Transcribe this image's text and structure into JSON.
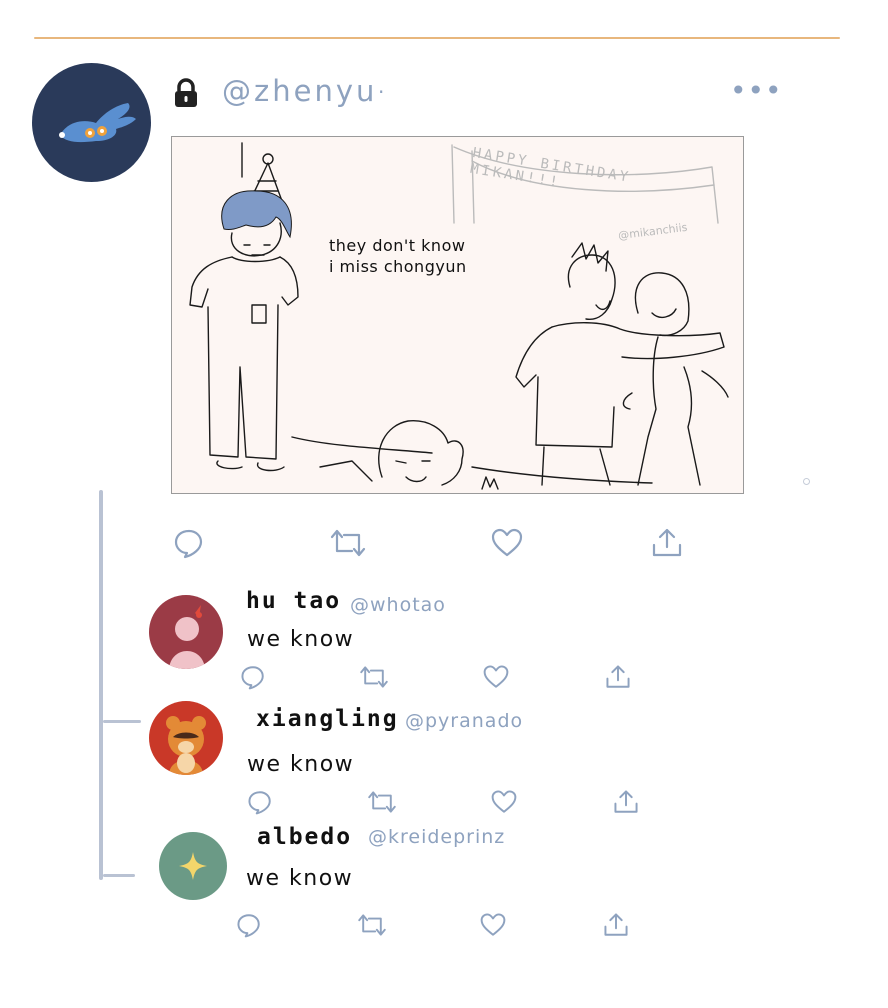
{
  "post": {
    "handle": "@zhenyu",
    "separator": "·",
    "more_label": "•••",
    "comic_text_line1": "they don't know",
    "comic_text_line2": "i miss chongyun",
    "comic_banner": "HAPPY BIRTHDAY MIKAN!!!",
    "comic_credit": "@mikanchiis"
  },
  "replies": [
    {
      "name": "hu tao",
      "handle": "@whotao",
      "text": "we know"
    },
    {
      "name": "xiangling",
      "handle": "@pyranado",
      "text": "we know"
    },
    {
      "name": "albedo",
      "handle": "@kreideprinz",
      "text": "we know"
    }
  ],
  "icons": {
    "lock": "lock-icon",
    "reply": "speech-bubble-icon",
    "retweet": "retweet-icon",
    "like": "heart-icon",
    "share": "share-icon"
  },
  "colors": {
    "accent_rule": "#e8b77d",
    "icon_blue": "#8ea2bf",
    "thread_line": "#b9c2d3",
    "avatar_main_bg": "#2a3a5a",
    "avatar_hutao_bg": "#9b3b46",
    "avatar_xiangling_bg": "#c93828",
    "avatar_albedo_bg": "#6b9a86"
  }
}
